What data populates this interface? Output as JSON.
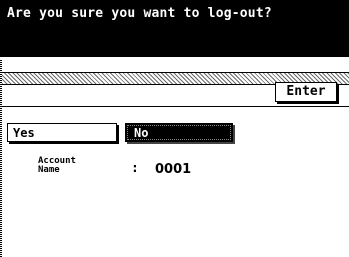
{
  "dialog": {
    "title": "Are you sure you want to log-out?"
  },
  "toolbar": {
    "enter_label": "Enter"
  },
  "choices": {
    "yes_label": "Yes",
    "no_label": "No",
    "selected": "No"
  },
  "account": {
    "label_line1": "Account",
    "label_line2": "Name",
    "separator": ":",
    "value": "0001"
  },
  "colors": {
    "background": "#ffffff",
    "title_bar": "#000000",
    "selected_button": "#000000"
  }
}
